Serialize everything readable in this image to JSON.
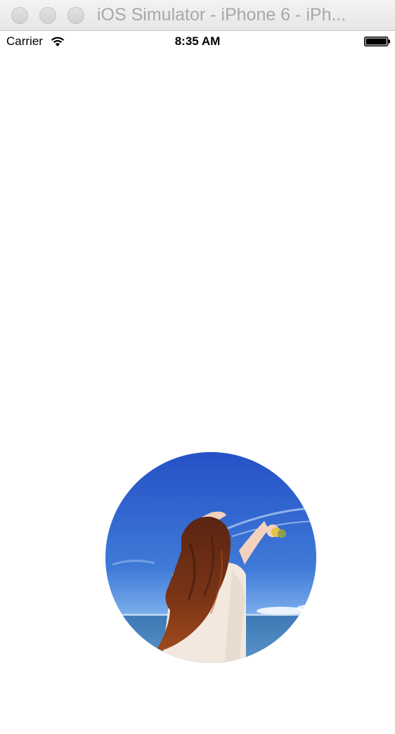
{
  "window": {
    "title": "iOS Simulator - iPhone 6 - iPh..."
  },
  "status_bar": {
    "carrier": "Carrier",
    "time": "8:35 AM",
    "icons": [
      "wifi-icon",
      "battery-icon"
    ]
  },
  "content": {
    "image": {
      "subject": "avatar-photo",
      "shape": "circle"
    }
  },
  "colors": {
    "sky_top": "#2857c8",
    "sky_bottom": "#7fb0ee",
    "sea": "#3f78b8",
    "hair": "#6b2c16",
    "dress": "#f1e6dc"
  }
}
